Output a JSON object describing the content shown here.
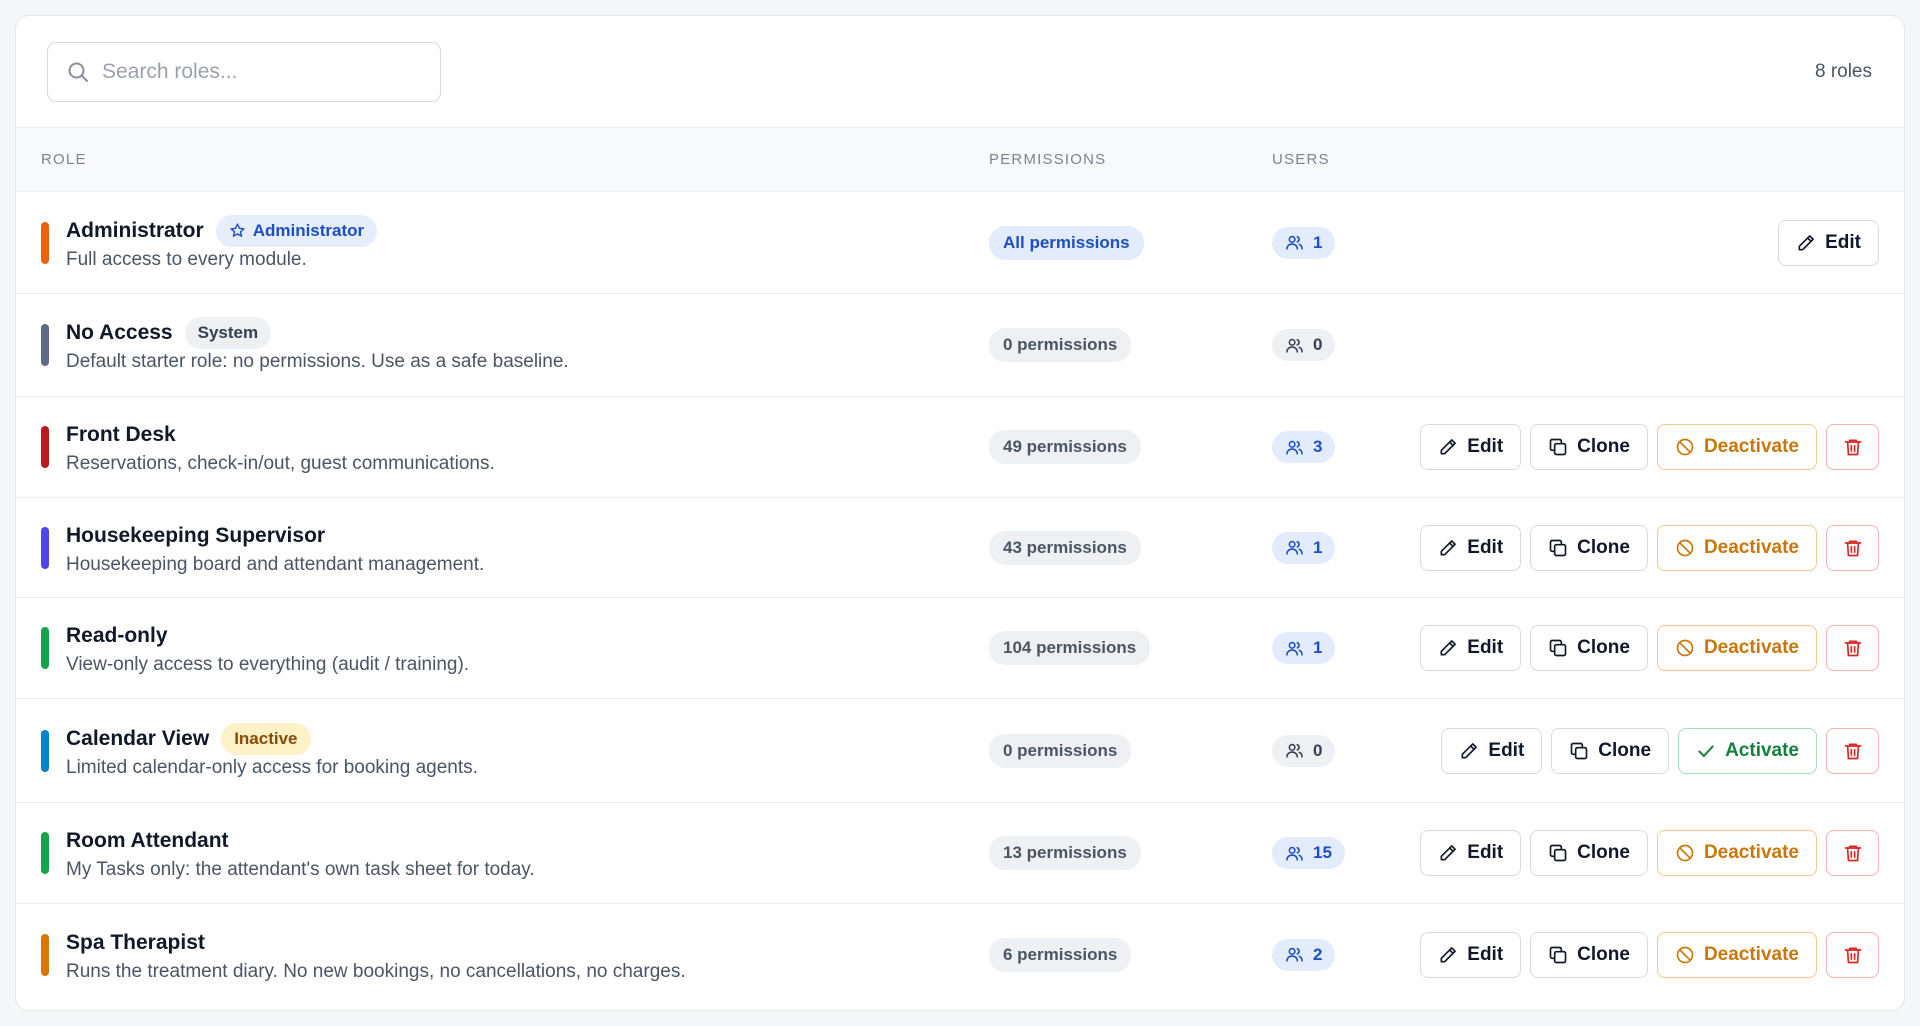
{
  "search": {
    "placeholder": "Search roles...",
    "value": ""
  },
  "roles_count": "8 roles",
  "table": {
    "headers": {
      "role": "ROLE",
      "permissions": "PERMISSIONS",
      "users": "USERS"
    }
  },
  "labels": {
    "edit": "Edit",
    "clone": "Clone",
    "deactivate": "Deactivate",
    "activate": "Activate"
  },
  "roles": [
    {
      "name": "Administrator",
      "description": "Full access to every module.",
      "color": "#e8620f",
      "tag": "Administrator",
      "tag_type": "admin",
      "permissions": "All permissions",
      "users": "1",
      "actions": [
        "edit"
      ]
    },
    {
      "name": "No Access",
      "description": "Default starter role: no permissions. Use as a safe baseline.",
      "color": "#5e6b80",
      "tag": "System",
      "tag_type": "system",
      "permissions": "0 permissions",
      "users": "0",
      "actions": []
    },
    {
      "name": "Front Desk",
      "description": "Reservations, check-in/out, guest communications.",
      "color": "#b91c1c",
      "permissions": "49 permissions",
      "users": "3",
      "actions": [
        "edit",
        "clone",
        "deactivate",
        "delete"
      ]
    },
    {
      "name": "Housekeeping Supervisor",
      "description": "Housekeeping board and attendant management.",
      "color": "#4f46e5",
      "permissions": "43 permissions",
      "users": "1",
      "actions": [
        "edit",
        "clone",
        "deactivate",
        "delete"
      ]
    },
    {
      "name": "Read-only",
      "description": "View-only access to everything (audit / training).",
      "color": "#16a34a",
      "permissions": "104 permissions",
      "users": "1",
      "actions": [
        "edit",
        "clone",
        "deactivate",
        "delete"
      ]
    },
    {
      "name": "Calendar View",
      "description": "Limited calendar-only access for booking agents.",
      "color": "#0284c7",
      "tag": "Inactive",
      "tag_type": "inactive",
      "permissions": "0 permissions",
      "users": "0",
      "actions": [
        "edit",
        "clone",
        "activate",
        "delete"
      ]
    },
    {
      "name": "Room Attendant",
      "description": "My Tasks only: the attendant's own task sheet for today.",
      "color": "#16a34a",
      "permissions": "13 permissions",
      "users": "15",
      "actions": [
        "edit",
        "clone",
        "deactivate",
        "delete"
      ]
    },
    {
      "name": "Spa Therapist",
      "description": "Runs the treatment diary. No new bookings, no cancellations, no charges.",
      "color": "#d97706",
      "permissions": "6 permissions",
      "users": "2",
      "actions": [
        "edit",
        "clone",
        "deactivate",
        "delete"
      ]
    }
  ]
}
